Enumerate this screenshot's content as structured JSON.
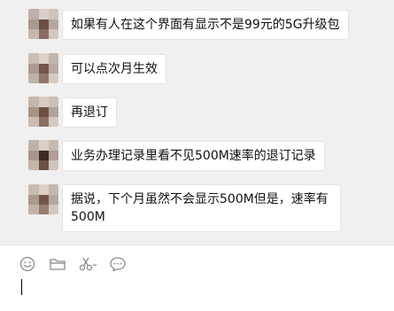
{
  "conversation": {
    "messages": [
      {
        "text": "如果有人在这个界面有显示不是99元的5G升级包"
      },
      {
        "text": "可以点次月生效"
      },
      {
        "text": "再退订"
      },
      {
        "text": "业务办理记录里看不见500M速率的退订记录"
      },
      {
        "text": "据说，下个月虽然不会显示500M但是，速率有500M"
      }
    ]
  },
  "toolbar": {
    "icons": [
      "emoji-icon",
      "folder-icon",
      "scissors-icon",
      "chat-bubble-icon"
    ]
  },
  "colors": {
    "chat_background": "#f0f0f0",
    "bubble_background": "#ffffff",
    "bubble_border": "#e3e3e3",
    "icon_color": "#8a8a8a",
    "text_color": "#111111"
  }
}
